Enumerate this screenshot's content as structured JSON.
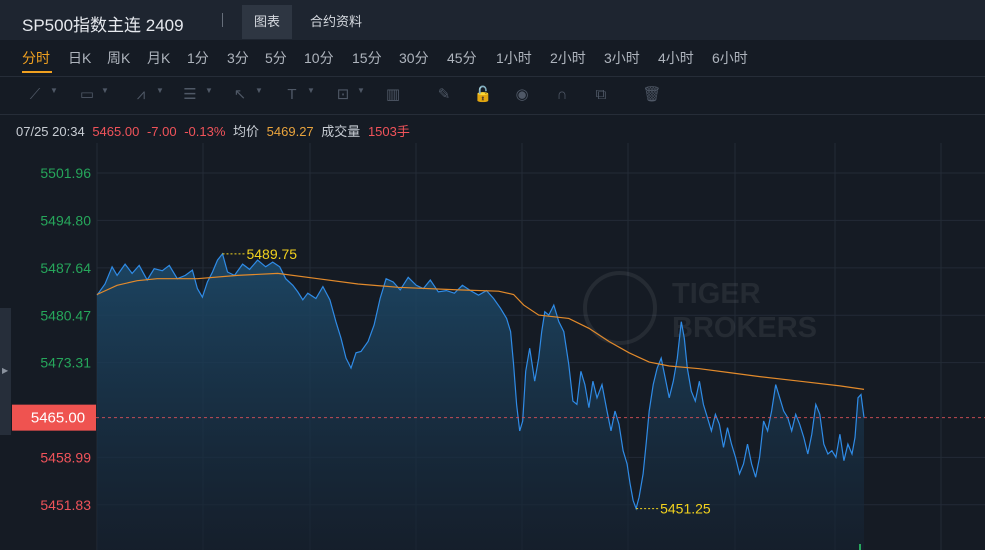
{
  "header": {
    "title": "SP500指数主连 2409",
    "tabs": [
      {
        "label": "图表",
        "active": true
      },
      {
        "label": "合约资料",
        "active": false
      }
    ]
  },
  "periods": [
    {
      "label": "分时",
      "active": true
    },
    {
      "label": "日K"
    },
    {
      "label": "周K"
    },
    {
      "label": "月K"
    },
    {
      "label": "1分"
    },
    {
      "label": "3分"
    },
    {
      "label": "5分"
    },
    {
      "label": "10分"
    },
    {
      "label": "15分"
    },
    {
      "label": "30分"
    },
    {
      "label": "45分"
    },
    {
      "label": "1小时"
    },
    {
      "label": "2小时"
    },
    {
      "label": "3小时"
    },
    {
      "label": "4小时"
    },
    {
      "label": "6小时"
    }
  ],
  "toolbar": {
    "tools": [
      {
        "name": "trend-line-icon",
        "glyph": "⟋"
      },
      {
        "name": "rectangle-icon",
        "glyph": "▭"
      },
      {
        "name": "wave-pattern-icon",
        "glyph": "⩘"
      },
      {
        "name": "fibonacci-icon",
        "glyph": "☰"
      },
      {
        "name": "arrow-icon",
        "glyph": "↖"
      },
      {
        "name": "text-icon",
        "glyph": "T"
      },
      {
        "name": "price-label-icon",
        "glyph": "⊡"
      },
      {
        "name": "bar-pattern-icon",
        "glyph": "▥"
      },
      {
        "name": "pencil-icon",
        "glyph": "✎"
      },
      {
        "name": "lock-icon",
        "glyph": "🔓"
      },
      {
        "name": "eye-icon",
        "glyph": "◉"
      },
      {
        "name": "magnet-icon",
        "glyph": "∩"
      },
      {
        "name": "duplicate-icon",
        "glyph": "⧉"
      },
      {
        "name": "trash-icon",
        "glyph": "🗑"
      }
    ]
  },
  "info": {
    "datetime": "07/25 20:34",
    "price": "5465.00",
    "change": "-7.00",
    "change_pct": "-0.13%",
    "avg_label": "均价",
    "avg_value": "5469.27",
    "volume_label": "成交量",
    "volume_value": "1503手"
  },
  "colors": {
    "up": "#26a65b",
    "down": "#f0535a",
    "price_line": "#2f8be6",
    "avg_line": "#e28a2b",
    "annotation": "#f2d21e"
  },
  "chart_data": {
    "type": "line",
    "y_ticks": [
      {
        "value": 5501.96,
        "label": "5501.96",
        "dir": "up"
      },
      {
        "value": 5494.8,
        "label": "5494.80",
        "dir": "up"
      },
      {
        "value": 5487.64,
        "label": "5487.64",
        "dir": "up"
      },
      {
        "value": 5480.47,
        "label": "5480.47",
        "dir": "up"
      },
      {
        "value": 5473.31,
        "label": "5473.31",
        "dir": "up"
      },
      {
        "value": 5458.99,
        "label": "5458.99",
        "dir": "down"
      },
      {
        "value": 5451.83,
        "label": "5451.83",
        "dir": "down"
      }
    ],
    "current_price": {
      "value": 5465.0,
      "label": "5465.00"
    },
    "ylim": [
      5445.0,
      5506.5
    ],
    "n_points": 765,
    "high_label": {
      "index": 125,
      "value": 5489.75,
      "text": "5489.75"
    },
    "low_label": {
      "index": 537,
      "value": 5451.25,
      "text": "5451.25"
    },
    "price_series": [
      [
        0,
        5483.5
      ],
      [
        8,
        5485.2
      ],
      [
        15,
        5487.8
      ],
      [
        20,
        5486.5
      ],
      [
        28,
        5488.2
      ],
      [
        35,
        5486.8
      ],
      [
        42,
        5488.0
      ],
      [
        50,
        5485.8
      ],
      [
        57,
        5487.5
      ],
      [
        65,
        5487.2
      ],
      [
        72,
        5488.0
      ],
      [
        80,
        5486.0
      ],
      [
        88,
        5486.5
      ],
      [
        95,
        5487.3
      ],
      [
        100,
        5484.5
      ],
      [
        105,
        5483.2
      ],
      [
        110,
        5485.5
      ],
      [
        115,
        5487.0
      ],
      [
        120,
        5488.8
      ],
      [
        125,
        5489.75
      ],
      [
        130,
        5487.0
      ],
      [
        137,
        5486.5
      ],
      [
        145,
        5488.2
      ],
      [
        152,
        5487.4
      ],
      [
        160,
        5488.8
      ],
      [
        168,
        5487.8
      ],
      [
        175,
        5488.5
      ],
      [
        182,
        5487.8
      ],
      [
        188,
        5486.0
      ],
      [
        195,
        5485.0
      ],
      [
        200,
        5484.0
      ],
      [
        205,
        5482.8
      ],
      [
        210,
        5483.8
      ],
      [
        218,
        5483.0
      ],
      [
        225,
        5484.8
      ],
      [
        232,
        5482.8
      ],
      [
        238,
        5479.5
      ],
      [
        243,
        5477.0
      ],
      [
        248,
        5474.0
      ],
      [
        253,
        5472.5
      ],
      [
        258,
        5474.8
      ],
      [
        263,
        5475.0
      ],
      [
        270,
        5476.5
      ],
      [
        276,
        5479.0
      ],
      [
        282,
        5483.0
      ],
      [
        288,
        5486.0
      ],
      [
        295,
        5485.5
      ],
      [
        302,
        5484.3
      ],
      [
        310,
        5486.2
      ],
      [
        318,
        5485.0
      ],
      [
        325,
        5484.5
      ],
      [
        332,
        5485.8
      ],
      [
        340,
        5484.0
      ],
      [
        348,
        5484.2
      ],
      [
        356,
        5483.8
      ],
      [
        364,
        5485.0
      ],
      [
        372,
        5484.2
      ],
      [
        380,
        5483.5
      ],
      [
        388,
        5484.2
      ],
      [
        395,
        5483.0
      ],
      [
        402,
        5481.5
      ],
      [
        408,
        5480.0
      ],
      [
        412,
        5478.0
      ],
      [
        415,
        5473.0
      ],
      [
        418,
        5467.0
      ],
      [
        421,
        5463.0
      ],
      [
        424,
        5464.5
      ],
      [
        427,
        5472.0
      ],
      [
        431,
        5475.5
      ],
      [
        436,
        5470.5
      ],
      [
        440,
        5474.0
      ],
      [
        443,
        5478.0
      ],
      [
        446,
        5481.0
      ],
      [
        450,
        5480.5
      ],
      [
        455,
        5482.0
      ],
      [
        460,
        5479.5
      ],
      [
        465,
        5478.0
      ],
      [
        470,
        5473.0
      ],
      [
        474,
        5467.5
      ],
      [
        478,
        5467.0
      ],
      [
        482,
        5472.0
      ],
      [
        486,
        5470.0
      ],
      [
        490,
        5466.5
      ],
      [
        494,
        5470.5
      ],
      [
        498,
        5468.0
      ],
      [
        503,
        5470.0
      ],
      [
        508,
        5466.0
      ],
      [
        512,
        5463.0
      ],
      [
        516,
        5466.0
      ],
      [
        520,
        5464.0
      ],
      [
        524,
        5460.0
      ],
      [
        528,
        5458.0
      ],
      [
        531,
        5455.0
      ],
      [
        534,
        5452.5
      ],
      [
        537,
        5451.25
      ],
      [
        540,
        5453.0
      ],
      [
        544,
        5456.5
      ],
      [
        547,
        5461.0
      ],
      [
        550,
        5466.0
      ],
      [
        554,
        5470.0
      ],
      [
        558,
        5472.5
      ],
      [
        562,
        5474.0
      ],
      [
        566,
        5471.0
      ],
      [
        570,
        5468.0
      ],
      [
        574,
        5470.5
      ],
      [
        578,
        5474.0
      ],
      [
        582,
        5479.5
      ],
      [
        585,
        5477.0
      ],
      [
        588,
        5472.5
      ],
      [
        592,
        5469.0
      ],
      [
        596,
        5467.5
      ],
      [
        600,
        5470.5
      ],
      [
        604,
        5467.0
      ],
      [
        608,
        5465.0
      ],
      [
        612,
        5463.0
      ],
      [
        616,
        5465.5
      ],
      [
        620,
        5464.0
      ],
      [
        624,
        5460.5
      ],
      [
        628,
        5463.5
      ],
      [
        632,
        5461.0
      ],
      [
        636,
        5459.0
      ],
      [
        640,
        5456.5
      ],
      [
        644,
        5458.0
      ],
      [
        648,
        5461.0
      ],
      [
        652,
        5458.0
      ],
      [
        656,
        5456.0
      ],
      [
        660,
        5459.0
      ],
      [
        664,
        5464.5
      ],
      [
        668,
        5463.0
      ],
      [
        672,
        5466.0
      ],
      [
        676,
        5470.0
      ],
      [
        680,
        5468.0
      ],
      [
        684,
        5466.0
      ],
      [
        688,
        5465.0
      ],
      [
        692,
        5463.0
      ],
      [
        696,
        5465.5
      ],
      [
        700,
        5464.0
      ],
      [
        704,
        5462.0
      ],
      [
        708,
        5459.5
      ],
      [
        712,
        5462.5
      ],
      [
        716,
        5467.0
      ],
      [
        720,
        5465.5
      ],
      [
        724,
        5461.0
      ],
      [
        728,
        5459.5
      ],
      [
        732,
        5460.0
      ],
      [
        736,
        5459.0
      ],
      [
        740,
        5462.5
      ],
      [
        744,
        5458.5
      ],
      [
        748,
        5461.0
      ],
      [
        752,
        5459.5
      ],
      [
        755,
        5462.0
      ],
      [
        758,
        5468.0
      ],
      [
        761,
        5468.5
      ],
      [
        764,
        5465.0
      ]
    ],
    "avg_series": [
      [
        0,
        5483.6
      ],
      [
        20,
        5485.0
      ],
      [
        40,
        5485.7
      ],
      [
        60,
        5486.0
      ],
      [
        100,
        5486.0
      ],
      [
        140,
        5486.5
      ],
      [
        180,
        5486.8
      ],
      [
        220,
        5486.0
      ],
      [
        260,
        5485.2
      ],
      [
        300,
        5484.7
      ],
      [
        360,
        5484.3
      ],
      [
        400,
        5484.1
      ],
      [
        415,
        5483.6
      ],
      [
        425,
        5482.0
      ],
      [
        440,
        5480.5
      ],
      [
        470,
        5480.0
      ],
      [
        490,
        5478.5
      ],
      [
        510,
        5476.5
      ],
      [
        530,
        5474.8
      ],
      [
        550,
        5473.4
      ],
      [
        570,
        5472.8
      ],
      [
        600,
        5472.4
      ],
      [
        630,
        5471.8
      ],
      [
        660,
        5471.2
      ],
      [
        700,
        5470.5
      ],
      [
        740,
        5469.8
      ],
      [
        764,
        5469.27
      ]
    ],
    "watermark": [
      "TIGER",
      "BROKERS"
    ]
  }
}
